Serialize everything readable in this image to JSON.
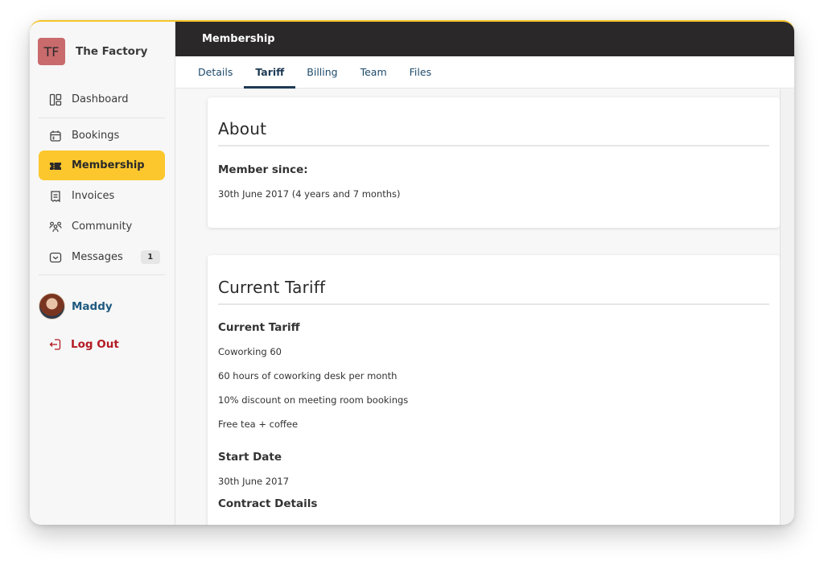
{
  "brand": {
    "initials": "TF",
    "name": "The Factory",
    "badge_color": "#c96a6c"
  },
  "sidebar": {
    "items": [
      {
        "id": "dashboard",
        "label": "Dashboard",
        "icon": "dashboard-icon"
      },
      {
        "id": "bookings",
        "label": "Bookings",
        "icon": "calendar-icon"
      },
      {
        "id": "membership",
        "label": "Membership",
        "icon": "ticket-icon",
        "active": true
      },
      {
        "id": "invoices",
        "label": "Invoices",
        "icon": "receipt-icon"
      },
      {
        "id": "community",
        "label": "Community",
        "icon": "community-icon"
      },
      {
        "id": "messages",
        "label": "Messages",
        "icon": "inbox-icon",
        "badge": "1"
      }
    ],
    "active_color": "#fcc72d"
  },
  "user": {
    "name": "Maddy",
    "logout_label": "Log Out"
  },
  "header": {
    "title": "Membership"
  },
  "tabs": [
    {
      "label": "Details"
    },
    {
      "label": "Tariff",
      "active": true
    },
    {
      "label": "Billing"
    },
    {
      "label": "Team"
    },
    {
      "label": "Files"
    }
  ],
  "about": {
    "title": "About",
    "member_since_label": "Member since:",
    "member_since_value": "30th June 2017 (4 years and 7 months)"
  },
  "tariff": {
    "title": "Current Tariff",
    "current_label": "Current Tariff",
    "lines": [
      "Coworking 60",
      "60 hours of coworking desk per month",
      "10% discount on meeting room bookings",
      "Free tea + coffee"
    ],
    "start_label": "Start Date",
    "start_value": "30th June 2017",
    "contract_label": "Contract Details"
  }
}
